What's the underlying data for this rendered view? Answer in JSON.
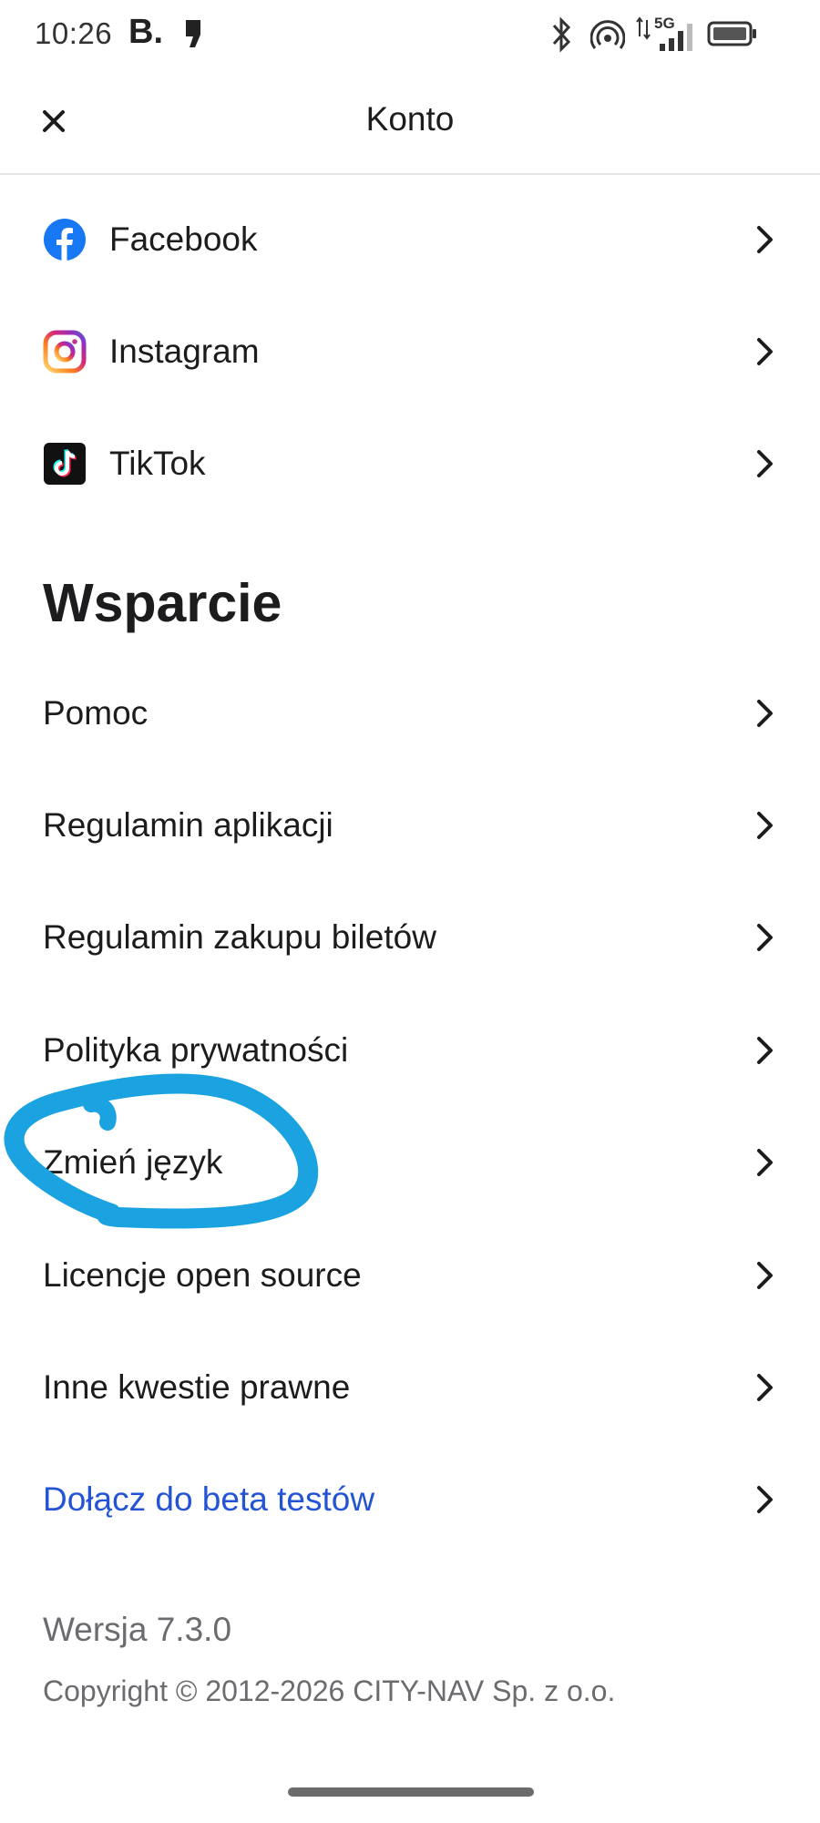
{
  "statusbar": {
    "time": "10:26",
    "brand": "B.",
    "icons": [
      "bluetooth-icon",
      "hotspot-icon",
      "mobile-data-icon",
      "signal-icon",
      "battery-icon"
    ],
    "network": "5G"
  },
  "header": {
    "title": "Konto",
    "close_icon": "close-icon"
  },
  "social": [
    {
      "label": "Facebook",
      "icon": "facebook-icon"
    },
    {
      "label": "Instagram",
      "icon": "instagram-icon"
    },
    {
      "label": "TikTok",
      "icon": "tiktok-icon"
    }
  ],
  "support": {
    "heading": "Wsparcie",
    "items": [
      {
        "label": "Pomoc"
      },
      {
        "label": "Regulamin aplikacji"
      },
      {
        "label": "Regulamin zakupu biletów"
      },
      {
        "label": "Polityka prywatności"
      },
      {
        "label": "Zmień język"
      },
      {
        "label": "Licencje open source"
      },
      {
        "label": "Inne kwestie prawne"
      },
      {
        "label": "Dołącz do beta testów"
      }
    ]
  },
  "footer": {
    "version": "Wersja 7.3.0",
    "copyright": "Copyright © 2012-2026 CITY-NAV Sp. z o.o."
  },
  "colors": {
    "link": "#2454d6",
    "annotation": "#1aa3e0",
    "facebook": "#1877f2",
    "text": "#1c1c1e",
    "secondary_text": "#6c6c70"
  }
}
